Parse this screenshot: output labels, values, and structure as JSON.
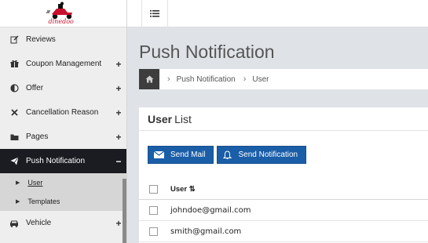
{
  "brand": {
    "logo_text": "dinedoo"
  },
  "sidebar": {
    "items": [
      {
        "label": "Reviews",
        "icon": "edit-icon",
        "toggle": ""
      },
      {
        "label": "Coupon Management",
        "icon": "gift-icon",
        "toggle": "+"
      },
      {
        "label": "Offer",
        "icon": "half-circle-icon",
        "toggle": "+"
      },
      {
        "label": "Cancellation Reason",
        "icon": "times-icon",
        "toggle": "+"
      },
      {
        "label": "Pages",
        "icon": "folder-icon",
        "toggle": "+"
      },
      {
        "label": "Push Notification",
        "icon": "paper-plane-icon",
        "toggle": "−"
      },
      {
        "label": "Vehicle",
        "icon": "car-icon",
        "toggle": "+"
      }
    ],
    "submenu": [
      {
        "label": "User"
      },
      {
        "label": "Templates"
      }
    ],
    "colors": {
      "active_bg": "#1a1c21"
    }
  },
  "header": {
    "menu_icon": "list-icon"
  },
  "page": {
    "title": "Push Notification",
    "breadcrumb": {
      "home_icon": "home-icon",
      "items": [
        "Push Notification",
        "User"
      ],
      "separator": "›"
    }
  },
  "card": {
    "title_bold": "User",
    "title_rest": "List",
    "buttons": [
      {
        "label": "Send Mail",
        "icon": "envelope-icon"
      },
      {
        "label": "Send Notification",
        "icon": "bell-icon"
      }
    ],
    "button_color": "#1b5ea8",
    "table": {
      "header": "User ⇅",
      "rows": [
        "johndoe@gmail.com",
        "smith@gmail.com"
      ]
    }
  }
}
